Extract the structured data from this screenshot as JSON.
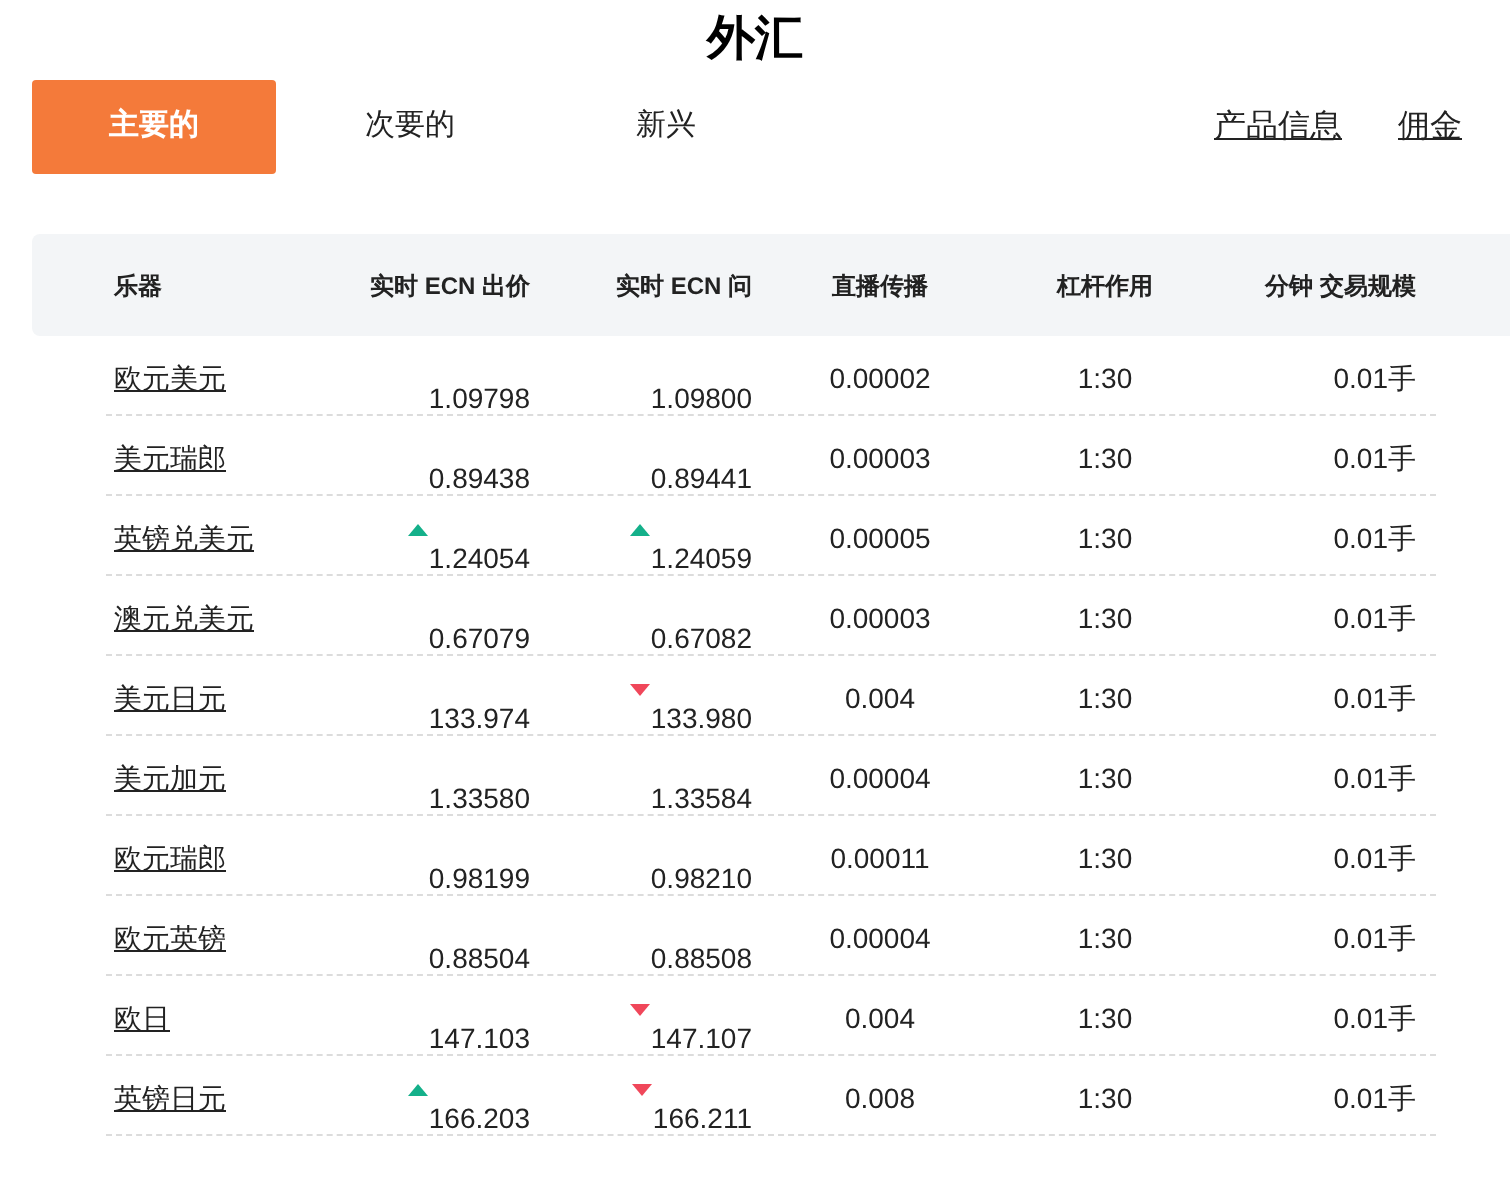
{
  "title": "外汇",
  "tabs": [
    {
      "label": "主要的",
      "selected": true
    },
    {
      "label": "次要的",
      "selected": false
    },
    {
      "label": "新兴",
      "selected": false
    }
  ],
  "links": [
    "产品信息",
    "佣金"
  ],
  "table": {
    "columns": [
      "乐器",
      "实时 ECN 出价",
      "实时 ECN 问",
      "直播传播",
      "杠杆作用",
      "分钟 交易规模"
    ],
    "rows": [
      {
        "name": "欧元美元",
        "bid": "1.09798",
        "bid_up": false,
        "bid_down": false,
        "ask": "1.09800",
        "ask_up": false,
        "ask_down": false,
        "spread": "0.00002",
        "leverage": "1:30",
        "size": "0.01手"
      },
      {
        "name": "美元瑞郎",
        "bid": "0.89438",
        "bid_up": false,
        "bid_down": false,
        "ask": "0.89441",
        "ask_up": false,
        "ask_down": false,
        "spread": "0.00003",
        "leverage": "1:30",
        "size": "0.01手"
      },
      {
        "name": "英镑兑美元",
        "bid": "1.24054",
        "bid_up": true,
        "bid_down": false,
        "ask": "1.24059",
        "ask_up": true,
        "ask_down": false,
        "spread": "0.00005",
        "leverage": "1:30",
        "size": "0.01手"
      },
      {
        "name": "澳元兑美元",
        "bid": "0.67079",
        "bid_up": false,
        "bid_down": false,
        "ask": "0.67082",
        "ask_up": false,
        "ask_down": false,
        "spread": "0.00003",
        "leverage": "1:30",
        "size": "0.01手"
      },
      {
        "name": "美元日元",
        "bid": "133.974",
        "bid_up": false,
        "bid_down": false,
        "ask": "133.980",
        "ask_up": false,
        "ask_down": true,
        "spread": "0.004",
        "leverage": "1:30",
        "size": "0.01手"
      },
      {
        "name": "美元加元",
        "bid": "1.33580",
        "bid_up": false,
        "bid_down": false,
        "ask": "1.33584",
        "ask_up": false,
        "ask_down": false,
        "spread": "0.00004",
        "leverage": "1:30",
        "size": "0.01手"
      },
      {
        "name": "欧元瑞郎",
        "bid": "0.98199",
        "bid_up": false,
        "bid_down": false,
        "ask": "0.98210",
        "ask_up": false,
        "ask_down": false,
        "spread": "0.00011",
        "leverage": "1:30",
        "size": "0.01手"
      },
      {
        "name": "欧元英镑",
        "bid": "0.88504",
        "bid_up": false,
        "bid_down": false,
        "ask": "0.88508",
        "ask_up": false,
        "ask_down": false,
        "spread": "0.00004",
        "leverage": "1:30",
        "size": "0.01手"
      },
      {
        "name": "欧日",
        "bid": "147.103",
        "bid_up": false,
        "bid_down": false,
        "ask": "147.107",
        "ask_up": false,
        "ask_down": true,
        "spread": "0.004",
        "leverage": "1:30",
        "size": "0.01手"
      },
      {
        "name": "英镑日元",
        "bid": "166.203",
        "bid_up": true,
        "bid_down": false,
        "ask": "166.211",
        "ask_up": false,
        "ask_down": true,
        "spread": "0.008",
        "leverage": "1:30",
        "size": "0.01手"
      }
    ]
  }
}
